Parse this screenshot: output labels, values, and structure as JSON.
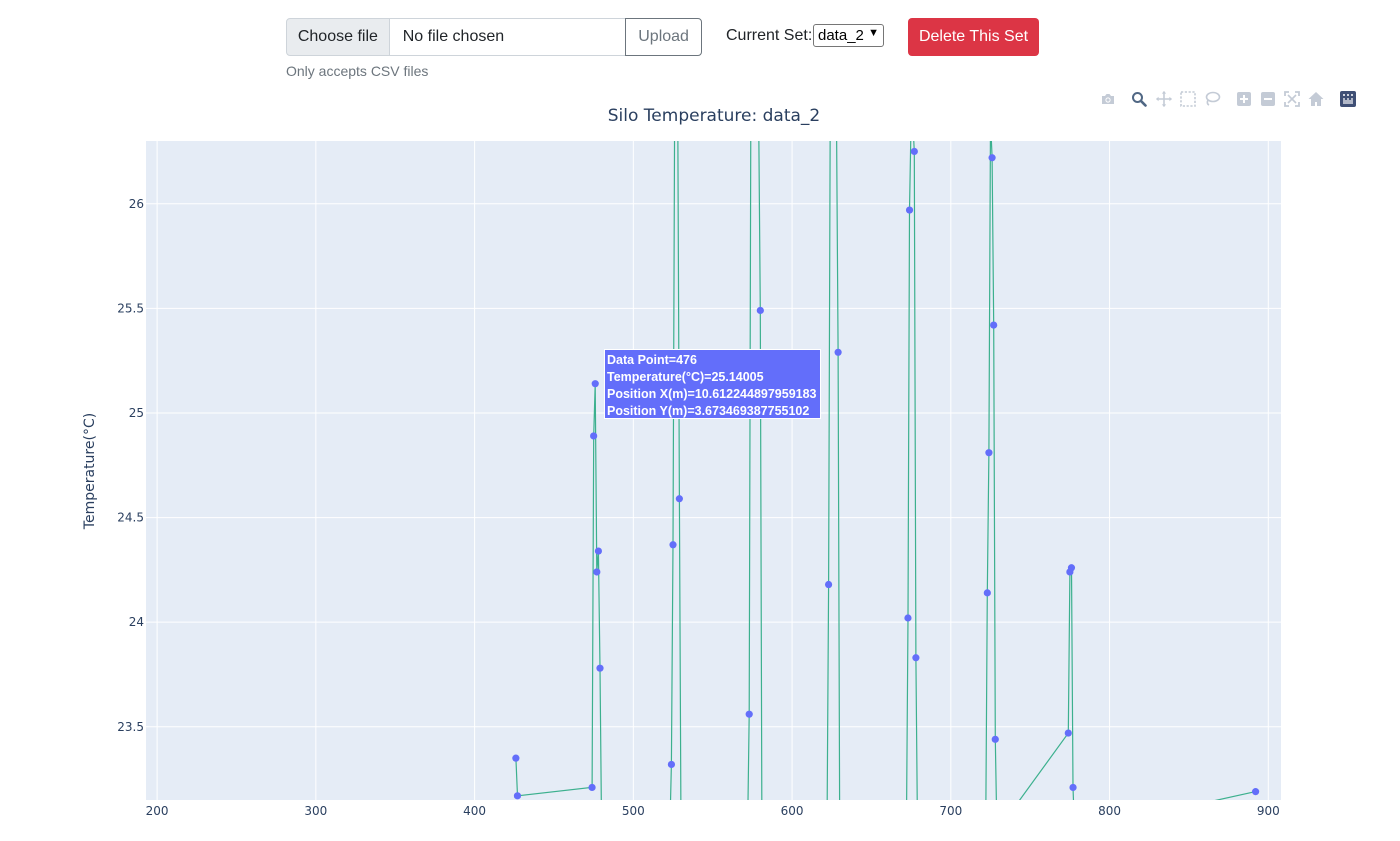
{
  "upload": {
    "choose_label": "Choose file",
    "file_status": "No file chosen",
    "upload_label": "Upload",
    "hint": "Only accepts CSV files"
  },
  "set_selector": {
    "label": "Current Set:",
    "selected": "data_2"
  },
  "delete_label": "Delete This Set",
  "modebar_icons": [
    "camera-icon",
    "zoom-icon",
    "pan-icon",
    "box-select-icon",
    "lasso-icon",
    "zoom-in-icon",
    "zoom-out-icon",
    "autoscale-icon",
    "reset-axes-icon",
    "plotly-logo-icon"
  ],
  "tooltip": {
    "line1": "Data Point=476",
    "line2": "Temperature(°C)=25.14005",
    "line3": "Position X(m)=10.612244897959183",
    "line4": "Position Y(m)=3.673469387755102"
  },
  "chart_data": {
    "type": "scatter",
    "mode": "lines+markers",
    "title": "Silo Temperature: data_2",
    "xlabel": "",
    "ylabel": "Temperature(°C)",
    "xlim": [
      193,
      908
    ],
    "ylim": [
      23.15,
      26.3
    ],
    "xticks": [
      200,
      300,
      400,
      500,
      600,
      700,
      800,
      900
    ],
    "yticks": [
      23.5,
      24,
      24.5,
      25,
      25.5,
      26
    ],
    "line_color": "#3cb08e",
    "marker_color": "#636efa",
    "points": [
      [
        426,
        23.35
      ],
      [
        427,
        23.17
      ],
      [
        474,
        23.21
      ],
      [
        475,
        24.89
      ],
      [
        476,
        25.14
      ],
      [
        477,
        24.24
      ],
      [
        478,
        24.34
      ],
      [
        479,
        23.78
      ],
      [
        480,
        23.0
      ],
      [
        523,
        23.0
      ],
      [
        524,
        23.32
      ],
      [
        525,
        24.37
      ],
      [
        526,
        26.4
      ],
      [
        527,
        26.4
      ],
      [
        528,
        26.4
      ],
      [
        529,
        24.59
      ],
      [
        530,
        23.0
      ],
      [
        572,
        23.0
      ],
      [
        573,
        23.56
      ],
      [
        574,
        26.4
      ],
      [
        575,
        26.4
      ],
      [
        579,
        26.4
      ],
      [
        580,
        25.49
      ],
      [
        581,
        23.0
      ],
      [
        622,
        23.0
      ],
      [
        623,
        24.18
      ],
      [
        624,
        26.4
      ],
      [
        628,
        26.4
      ],
      [
        629,
        25.29
      ],
      [
        630,
        23.0
      ],
      [
        672,
        23.0
      ],
      [
        673,
        24.02
      ],
      [
        674,
        25.97
      ],
      [
        675,
        26.4
      ],
      [
        676,
        26.4
      ],
      [
        677,
        26.25
      ],
      [
        678,
        23.83
      ],
      [
        679,
        23.0
      ],
      [
        722,
        23.0
      ],
      [
        723,
        24.14
      ],
      [
        724,
        24.81
      ],
      [
        725,
        26.4
      ],
      [
        726,
        26.22
      ],
      [
        727,
        25.42
      ],
      [
        728,
        23.44
      ],
      [
        729,
        23.0
      ],
      [
        774,
        23.47
      ],
      [
        775,
        24.24
      ],
      [
        776,
        24.26
      ],
      [
        777,
        23.21
      ],
      [
        778,
        23.0
      ],
      [
        892,
        23.19
      ]
    ]
  }
}
